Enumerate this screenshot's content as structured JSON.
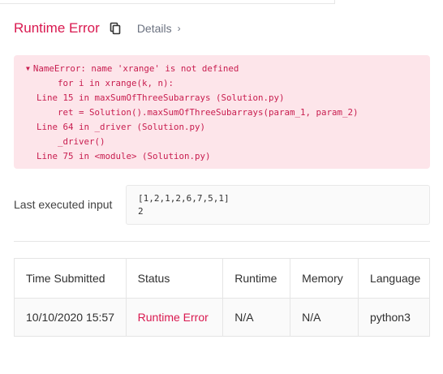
{
  "result": {
    "title": "Runtime Error",
    "details_label": "Details",
    "icons": {
      "copy": "copy-icon",
      "details": "chevron-right-icon",
      "traceback_toggle": "triangle-down-icon"
    },
    "colors": {
      "error": "#d9184f",
      "error_bg": "#fde5ea"
    }
  },
  "traceback": {
    "lines": [
      "NameError: name 'xrange' is not defined",
      "for i in xrange(k, n):",
      "Line 15 in maxSumOfThreeSubarrays (Solution.py)",
      "ret = Solution().maxSumOfThreeSubarrays(param_1, param_2)",
      "Line 64 in _driver (Solution.py)",
      "_driver()",
      "Line 75 in <module> (Solution.py)"
    ]
  },
  "last_input": {
    "label": "Last executed input",
    "lines": [
      "[1,2,1,2,6,7,5,1]",
      "2"
    ]
  },
  "submissions": {
    "headers": [
      "Time Submitted",
      "Status",
      "Runtime",
      "Memory",
      "Language"
    ],
    "rows": [
      [
        "10/10/2020 15:57",
        "Runtime Error",
        "N/A",
        "N/A",
        "python3"
      ]
    ]
  }
}
